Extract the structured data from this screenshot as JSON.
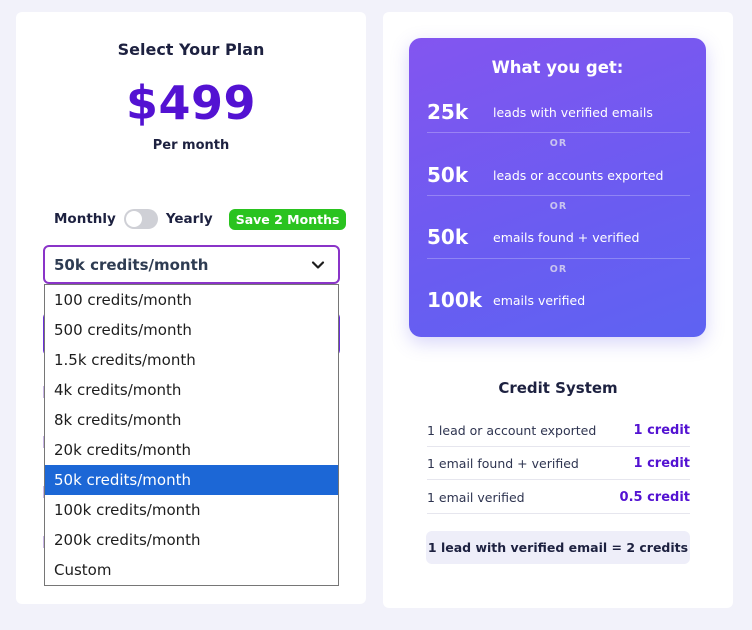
{
  "plan": {
    "title": "Select Your Plan",
    "price": "$499",
    "period": "Per month",
    "toggle": {
      "monthly_label": "Monthly",
      "yearly_label": "Yearly",
      "yearly_selected": false
    },
    "save_badge": "Save 2 Months",
    "select": {
      "selected": "50k credits/month",
      "options": [
        "100 credits/month",
        "500 credits/month",
        "1.5k credits/month",
        "4k credits/month",
        "8k credits/month",
        "20k credits/month",
        "50k credits/month",
        "100k credits/month",
        "200k credits/month",
        "Custom"
      ]
    }
  },
  "benefits": {
    "title": "What you get:",
    "separator": "OR",
    "items": [
      {
        "amount": "25k",
        "desc": "leads with verified emails"
      },
      {
        "amount": "50k",
        "desc": "leads or accounts exported"
      },
      {
        "amount": "50k",
        "desc": "emails found + verified"
      },
      {
        "amount": "100k",
        "desc": "emails verified"
      }
    ]
  },
  "credits": {
    "title": "Credit System",
    "rows": [
      {
        "label": "1 lead or account exported",
        "cost": "1 credit"
      },
      {
        "label": "1 email found + verified",
        "cost": "1 credit"
      },
      {
        "label": "1 email verified",
        "cost": "0.5 credit"
      }
    ],
    "summary": "1 lead with verified email = 2 credits"
  },
  "colors": {
    "accent": "#5312d2",
    "badge": "#2ac31f",
    "highlight": "#1c67d6",
    "select_border": "#8a34c8"
  }
}
